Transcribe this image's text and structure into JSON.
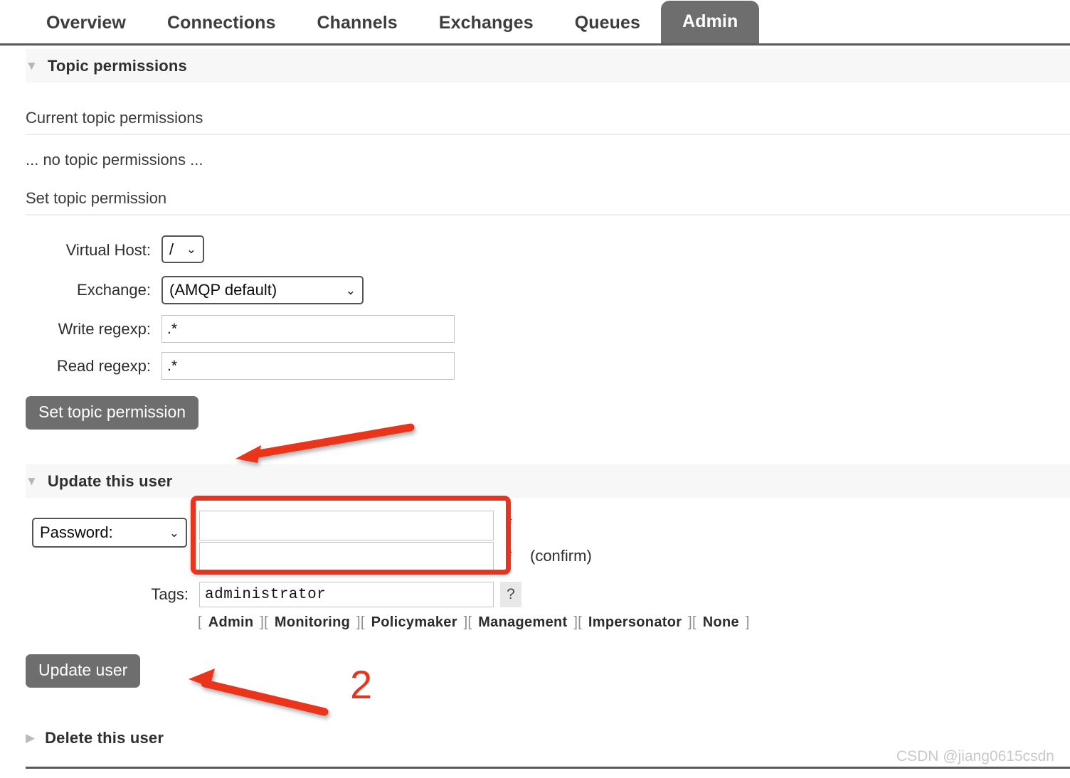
{
  "nav": {
    "tabs": [
      {
        "label": "Overview",
        "active": false
      },
      {
        "label": "Connections",
        "active": false
      },
      {
        "label": "Channels",
        "active": false
      },
      {
        "label": "Exchanges",
        "active": false
      },
      {
        "label": "Queues",
        "active": false
      },
      {
        "label": "Admin",
        "active": true
      }
    ]
  },
  "topic_permissions": {
    "section_title": "Topic permissions",
    "collapse_glyph": "▼",
    "current_heading": "Current topic permissions",
    "empty_text": "... no topic permissions ...",
    "set_heading": "Set topic permission",
    "fields": {
      "vhost_label": "Virtual Host:",
      "vhost_value": "/",
      "exchange_label": "Exchange:",
      "exchange_value": "(AMQP default)",
      "write_label": "Write regexp:",
      "write_value": ".*",
      "read_label": "Read regexp:",
      "read_value": ".*"
    },
    "submit_label": "Set topic permission"
  },
  "update_user": {
    "section_title": "Update this user",
    "collapse_glyph": "▼",
    "auth_mode": "Password:",
    "password_value": "",
    "password_confirm_value": "",
    "required_mark": "*",
    "confirm_note": "(confirm)",
    "tags_label": "Tags:",
    "tags_value": "administrator",
    "help_label": "?",
    "tag_links": [
      "Admin",
      "Monitoring",
      "Policymaker",
      "Management",
      "Impersonator",
      "None"
    ],
    "bracket_open": "[",
    "bracket_close": "]",
    "submit_label": "Update user"
  },
  "delete_user": {
    "section_title": "Delete this user",
    "collapse_glyph": "▶"
  },
  "annotations": {
    "step_number": "2",
    "highlight_color": "#e8341f"
  },
  "footer": {
    "watermark": "CSDN @jiang0615csdn"
  }
}
